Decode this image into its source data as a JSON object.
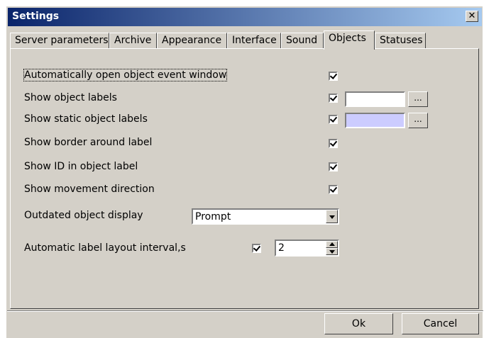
{
  "window": {
    "title": "Settings",
    "close_glyph": "✕"
  },
  "tabs": [
    {
      "label": "Server parameters"
    },
    {
      "label": "Archive"
    },
    {
      "label": "Appearance"
    },
    {
      "label": "Interface"
    },
    {
      "label": "Sound"
    },
    {
      "label": "Objects",
      "active": true
    },
    {
      "label": "Statuses"
    }
  ],
  "options": {
    "auto_open_event_window": {
      "label": "Automatically open object event window",
      "checked": true
    },
    "show_object_labels": {
      "label": "Show object labels",
      "checked": true,
      "color": "#ffffff",
      "browse_label": "..."
    },
    "show_static_object_labels": {
      "label": "Show static object labels",
      "checked": true,
      "color": "#ccccff",
      "browse_label": "..."
    },
    "show_border_around_label": {
      "label": "Show border around label",
      "checked": true
    },
    "show_id_in_label": {
      "label": "Show ID in object label",
      "checked": true
    },
    "show_movement_direction": {
      "label": "Show movement direction",
      "checked": true
    },
    "outdated_object_display": {
      "label": "Outdated object display",
      "value": "Prompt"
    },
    "auto_label_layout_interval": {
      "label": "Automatic label layout interval,s",
      "checked": true,
      "value": "2"
    }
  },
  "buttons": {
    "ok": "Ok",
    "cancel": "Cancel"
  }
}
